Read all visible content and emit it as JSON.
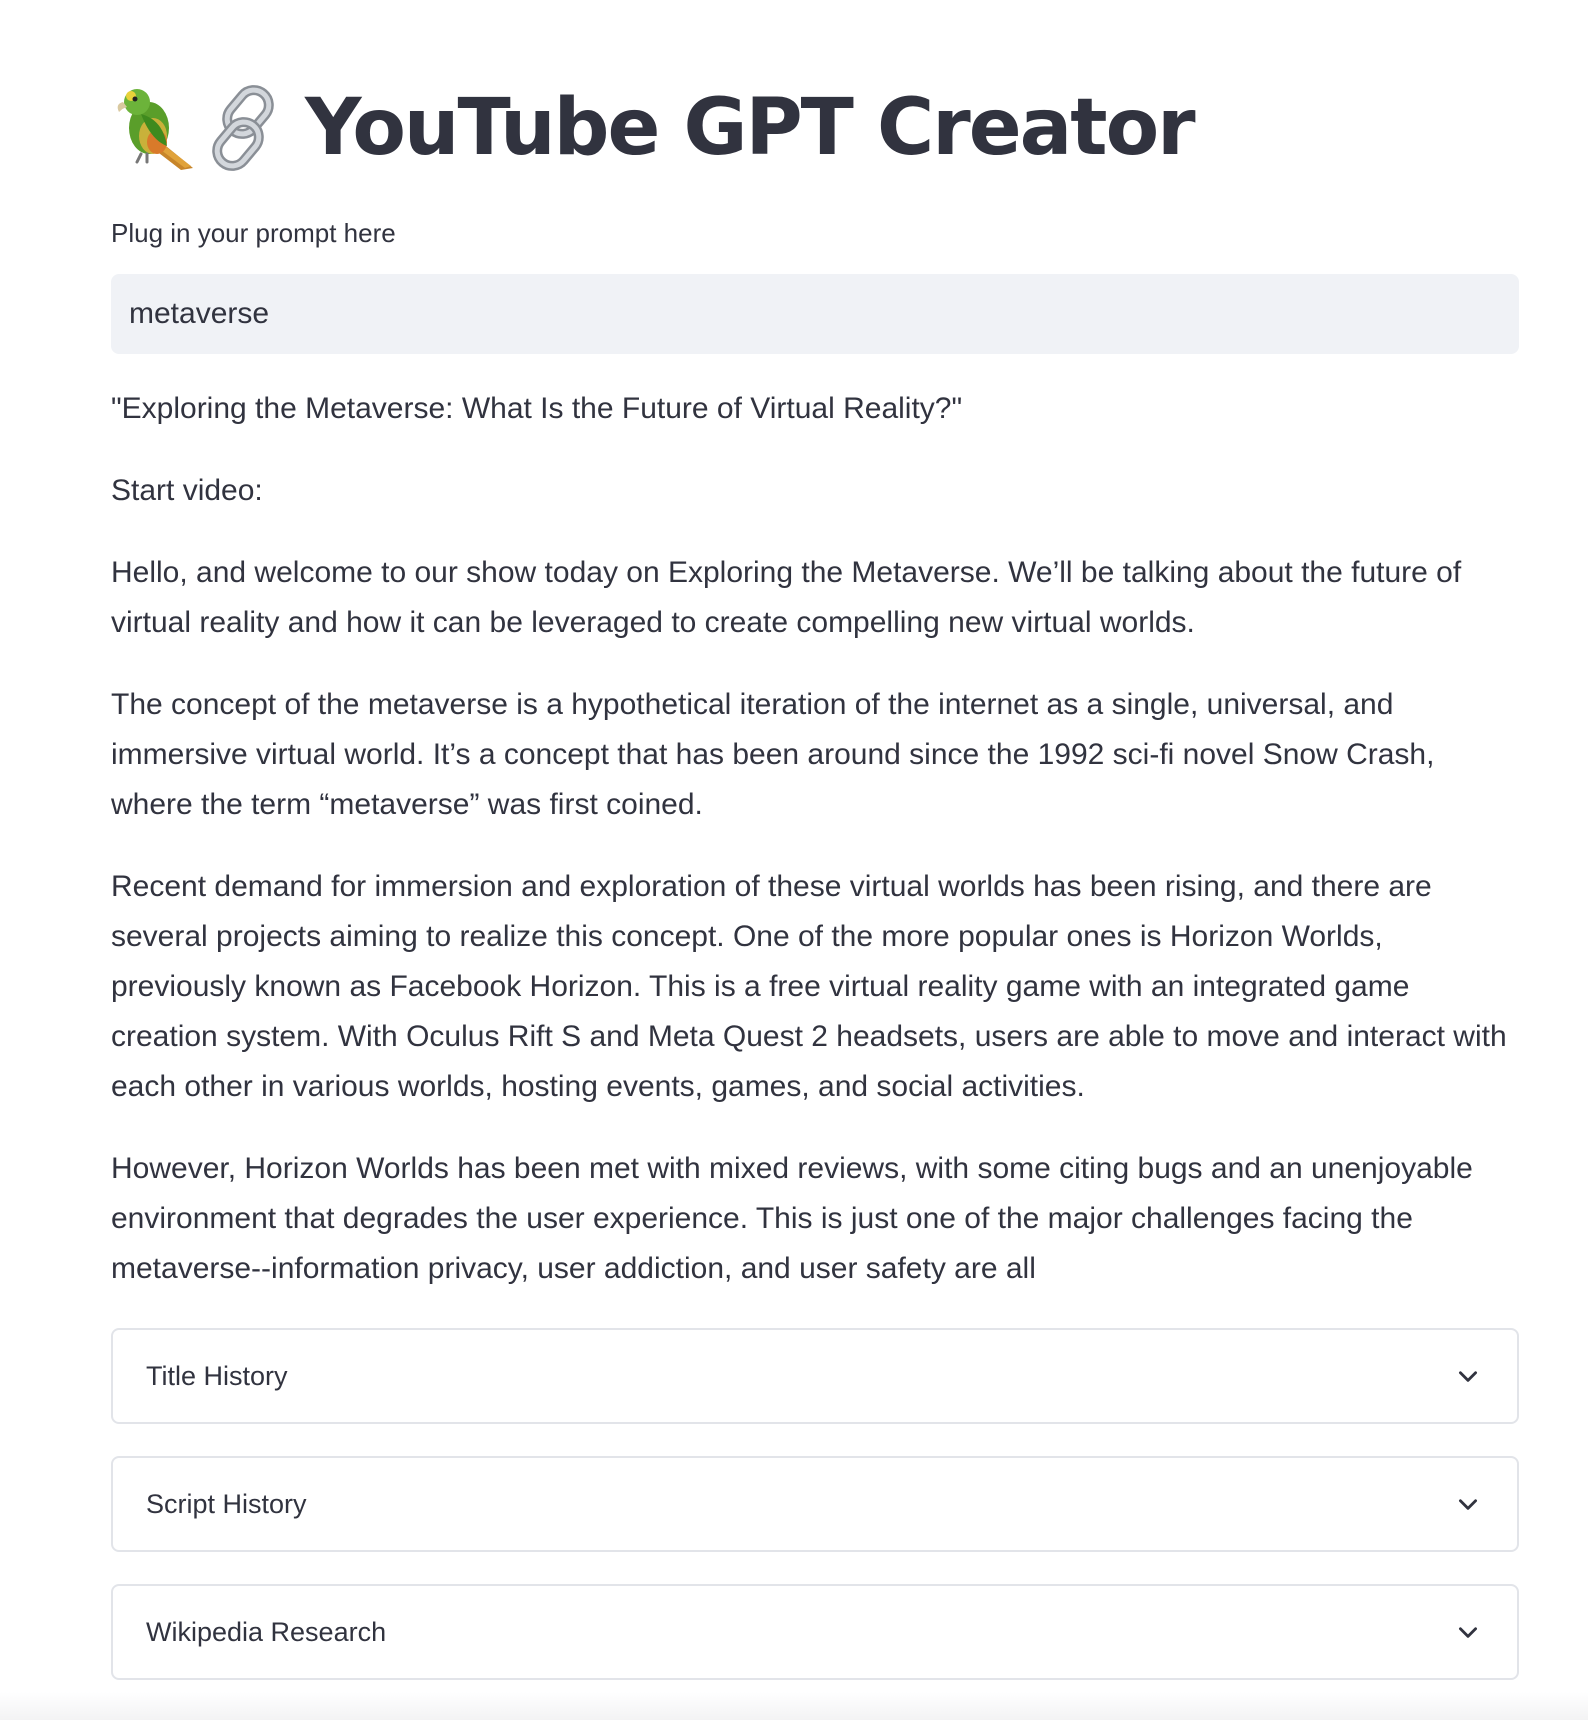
{
  "header": {
    "emoji_names": [
      "parrot-icon",
      "link-icon"
    ],
    "title": "YouTube GPT Creator"
  },
  "prompt_input": {
    "label": "Plug in your prompt here",
    "value": "metaverse"
  },
  "output": {
    "title_line": "\"Exploring the Metaverse: What Is the Future of Virtual Reality?\"",
    "script_paragraphs": [
      "Start video:",
      "Hello, and welcome to our show today on Exploring the Metaverse. We’ll be talking about the future of virtual reality and how it can be leveraged to create compelling new virtual worlds.",
      "The concept of the metaverse is a hypothetical iteration of the internet as a single, universal, and immersive virtual world. It’s a concept that has been around since the 1992 sci-fi novel Snow Crash, where the term “metaverse” was first coined.",
      "Recent demand for immersion and exploration of these virtual worlds has been rising, and there are several projects aiming to realize this concept. One of the more popular ones is Horizon Worlds, previously known as Facebook Horizon. This is a free virtual reality game with an integrated game creation system. With Oculus Rift S and Meta Quest 2 headsets, users are able to move and interact with each other in various worlds, hosting events, games, and social activities.",
      "However, Horizon Worlds has been met with mixed reviews, with some citing bugs and an unenjoyable environment that degrades the user experience. This is just one of the major challenges facing the metaverse--information privacy, user addiction, and user safety are all"
    ]
  },
  "expanders": [
    {
      "label": "Title History",
      "icon": "chevron-down-icon"
    },
    {
      "label": "Script History",
      "icon": "chevron-down-icon"
    },
    {
      "label": "Wikipedia Research",
      "icon": "chevron-down-icon"
    }
  ],
  "colors": {
    "text": "#31333f",
    "input_bg": "#f0f2f6",
    "border": "#e2e4e9",
    "spellcheck": "#e0443e"
  }
}
